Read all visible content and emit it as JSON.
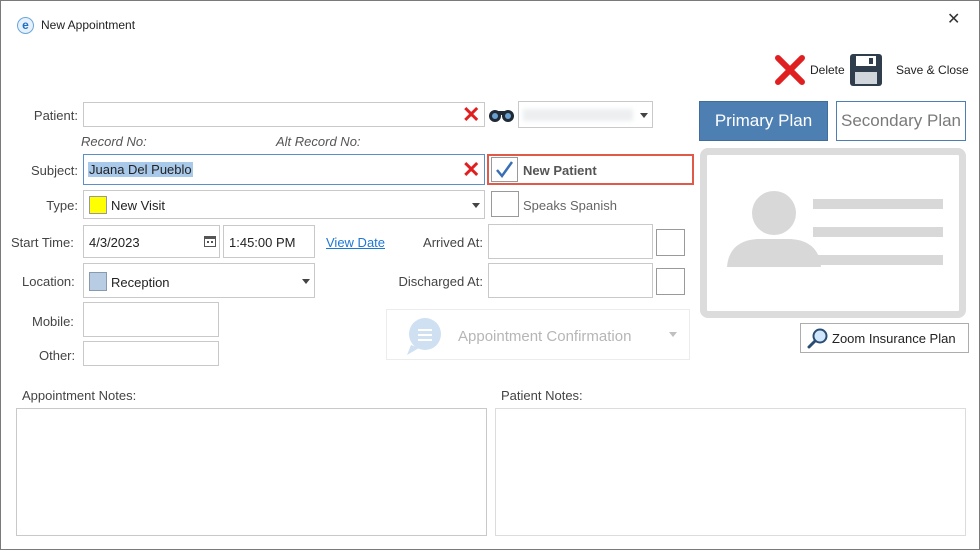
{
  "window": {
    "title": "New Appointment"
  },
  "toolbar": {
    "delete_label": "Delete",
    "save_close_label": "Save & Close"
  },
  "form": {
    "patient_label": "Patient:",
    "patient_value": "",
    "record_no_label": "Record No:",
    "alt_record_no_label": "Alt Record No:",
    "subject_label": "Subject:",
    "subject_value": "Juana Del Pueblo",
    "new_patient_label": "New Patient",
    "type_label": "Type:",
    "type_value": "New Visit",
    "type_color": "#ffff00",
    "speaks_spanish_label": "Speaks Spanish",
    "start_time_label": "Start Time:",
    "start_date": "4/3/2023",
    "start_time": "1:45:00 PM",
    "view_date_label": "View Date",
    "arrived_label": "Arrived At:",
    "location_label": "Location:",
    "location_value": "Reception",
    "location_color": "#b8cce4",
    "discharged_label": "Discharged At:",
    "mobile_label": "Mobile:",
    "other_label": "Other:",
    "confirmation_label": "Appointment Confirmation",
    "appointment_notes_label": "Appointment Notes:",
    "patient_notes_label": "Patient Notes:"
  },
  "insurance": {
    "primary_label": "Primary Plan",
    "secondary_label": "Secondary Plan",
    "zoom_label": "Zoom Insurance Plan"
  },
  "colors": {
    "accent": "#4d7fb2",
    "highlight_border": "#e05a4a",
    "selection": "#a9c9ea"
  }
}
